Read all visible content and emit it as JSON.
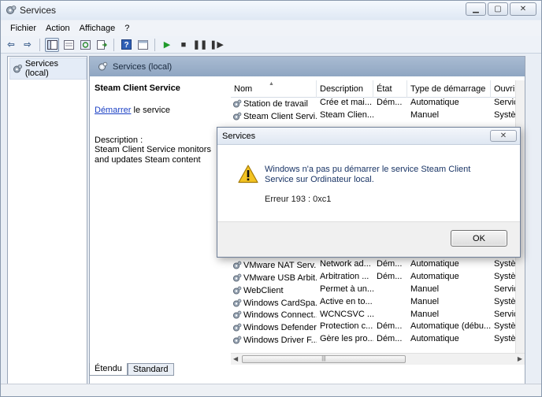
{
  "window": {
    "title": "Services"
  },
  "menu": [
    "Fichier",
    "Action",
    "Affichage",
    "?"
  ],
  "tree": {
    "label": "Services (local)"
  },
  "main": {
    "header": "Services (local)",
    "service_name": "Steam Client Service",
    "link_text": "Démarrer",
    "link_suffix": " le service",
    "description_label": "Description :",
    "description": "Steam Client Service monitors and updates Steam content"
  },
  "columns": [
    "Nom",
    "Description",
    "État",
    "Type de démarrage",
    "Ouvrir un"
  ],
  "rows": [
    {
      "name": "Station de travail",
      "desc": "Crée et mai...",
      "state": "Dém...",
      "startup": "Automatique",
      "logon": "Service re"
    },
    {
      "name": "Steam Client Servi...",
      "desc": "Steam Clien...",
      "state": "",
      "startup": "Manuel",
      "logon": "Système"
    },
    {
      "name": "",
      "desc": "",
      "state": "",
      "startup": "",
      "logon": ""
    },
    {
      "name": "",
      "desc": "",
      "state": "",
      "startup": "",
      "logon": ""
    },
    {
      "name": "",
      "desc": "",
      "state": "",
      "startup": "",
      "logon": ""
    },
    {
      "name": "",
      "desc": "",
      "state": "",
      "startup": "",
      "logon": ""
    },
    {
      "name": "",
      "desc": "",
      "state": "",
      "startup": "",
      "logon": ""
    },
    {
      "name": "",
      "desc": "",
      "state": "",
      "startup": "",
      "logon": ""
    },
    {
      "name": "",
      "desc": "",
      "state": "",
      "startup": "",
      "logon": ""
    },
    {
      "name": "",
      "desc": "",
      "state": "",
      "startup": "",
      "logon": ""
    },
    {
      "name": "",
      "desc": "",
      "state": "",
      "startup": "",
      "logon": ""
    },
    {
      "name": "",
      "desc": "",
      "state": "",
      "startup": "",
      "logon": ""
    },
    {
      "name": "",
      "desc": "",
      "state": "",
      "startup": "",
      "logon": ""
    },
    {
      "name": "VMware NAT Serv...",
      "desc": "Network ad...",
      "state": "Dém...",
      "startup": "Automatique",
      "logon": "Système"
    },
    {
      "name": "VMware USB Arbit...",
      "desc": "Arbitration ...",
      "state": "Dém...",
      "startup": "Automatique",
      "logon": "Système"
    },
    {
      "name": "WebClient",
      "desc": "Permet à un...",
      "state": "",
      "startup": "Manuel",
      "logon": "Service lo"
    },
    {
      "name": "Windows CardSpa...",
      "desc": "Active en to...",
      "state": "",
      "startup": "Manuel",
      "logon": "Système"
    },
    {
      "name": "Windows Connect...",
      "desc": "WCNCSVC ...",
      "state": "",
      "startup": "Manuel",
      "logon": "Service lo"
    },
    {
      "name": "Windows Defender",
      "desc": "Protection c...",
      "state": "Dém...",
      "startup": "Automatique (débu...",
      "logon": "Système"
    },
    {
      "name": "Windows Driver F...",
      "desc": "Gère les pro...",
      "state": "Dém...",
      "startup": "Automatique",
      "logon": "Système"
    }
  ],
  "tabs": [
    "Étendu",
    "Standard"
  ],
  "dialog": {
    "title": "Services",
    "message": "Windows n'a pas pu démarrer le service Steam Client Service sur Ordinateur local.",
    "error": "Erreur 193 : 0xc1",
    "ok_label": "OK"
  },
  "colors": {
    "link": "#1a3fc4",
    "header": "#9fb3cc",
    "dialog_text": "#1a3566"
  },
  "icons": [
    "services-icon",
    "back-icon",
    "forward-icon",
    "play-icon",
    "stop-icon",
    "pause-icon",
    "restart-icon",
    "warning-icon",
    "gear-icon"
  ]
}
